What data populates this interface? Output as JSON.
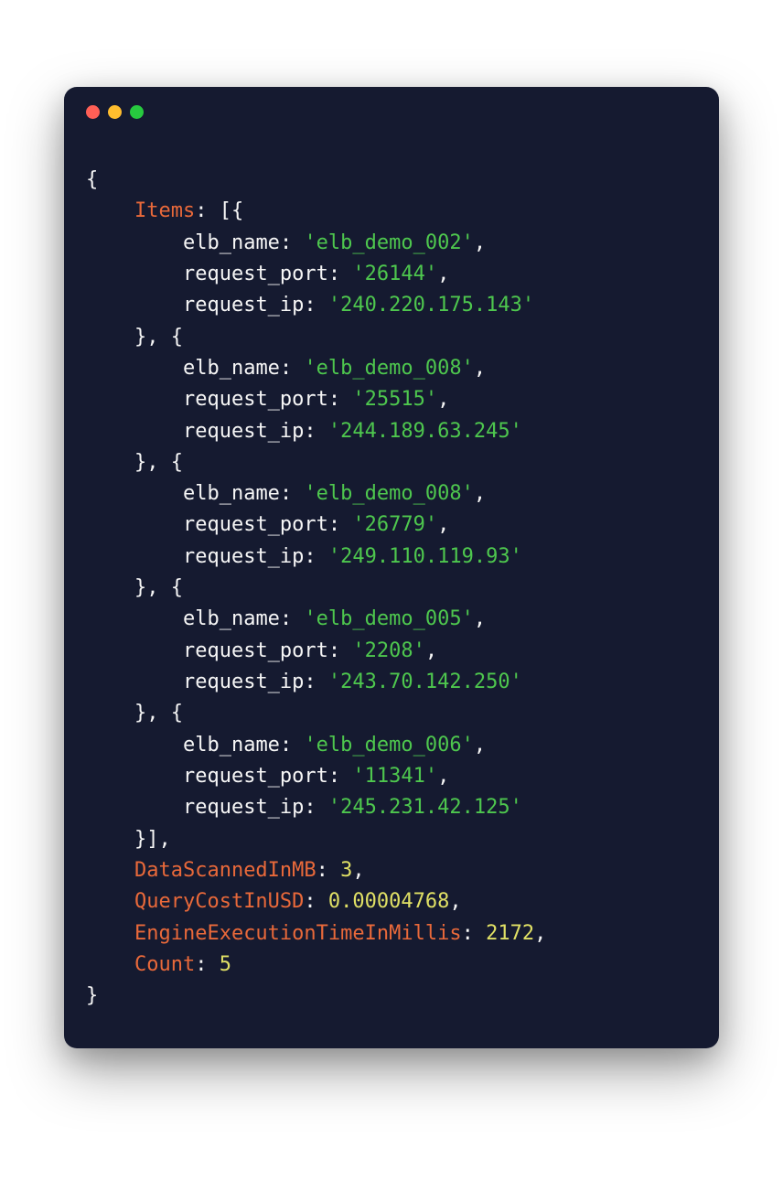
{
  "code": {
    "items_key": "Items",
    "elb_name_key": "elb_name",
    "request_port_key": "request_port",
    "request_ip_key": "request_ip",
    "data_scanned_key": "DataScannedInMB",
    "query_cost_key": "QueryCostInUSD",
    "engine_time_key": "EngineExecutionTimeInMillis",
    "count_key": "Count",
    "items": [
      {
        "elb_name": "'elb_demo_002'",
        "request_port": "'26144'",
        "request_ip": "'240.220.175.143'"
      },
      {
        "elb_name": "'elb_demo_008'",
        "request_port": "'25515'",
        "request_ip": "'244.189.63.245'"
      },
      {
        "elb_name": "'elb_demo_008'",
        "request_port": "'26779'",
        "request_ip": "'249.110.119.93'"
      },
      {
        "elb_name": "'elb_demo_005'",
        "request_port": "'2208'",
        "request_ip": "'243.70.142.250'"
      },
      {
        "elb_name": "'elb_demo_006'",
        "request_port": "'11341'",
        "request_ip": "'245.231.42.125'"
      }
    ],
    "data_scanned_value": "3",
    "query_cost_value": "0.00004768",
    "engine_time_value": "2172",
    "count_value": "5",
    "brace_open": "{",
    "brace_close": "}",
    "bracket_open": "[{",
    "bracket_mid": "}, {",
    "bracket_close": "}]",
    "colon": ": ",
    "comma": ","
  }
}
